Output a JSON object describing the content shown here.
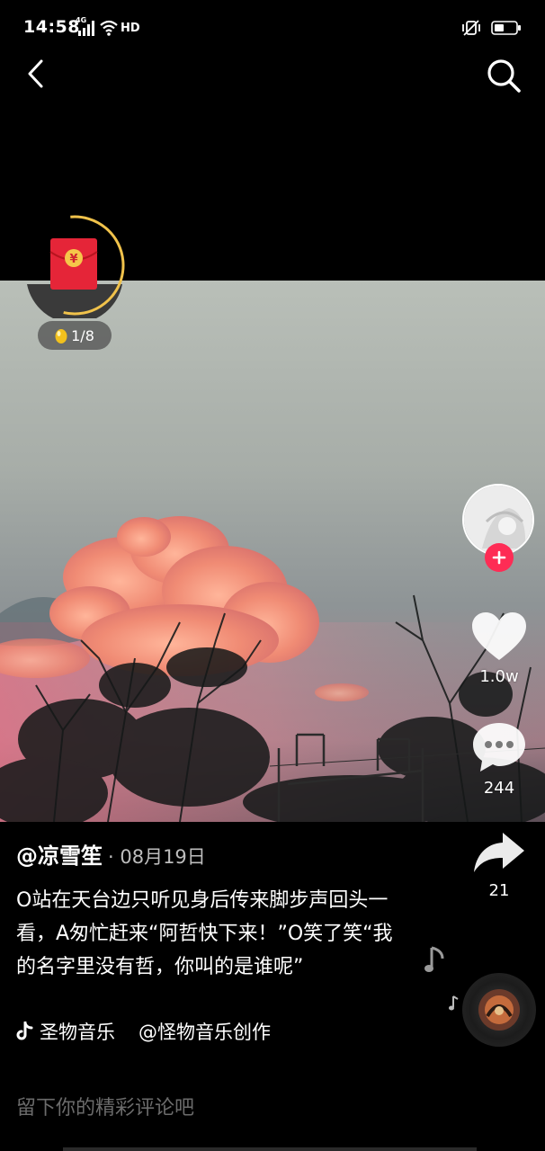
{
  "status_bar": {
    "time": "14:58",
    "network_label": "4G",
    "hd_label": "HD",
    "icons_left": [
      "signal-icon",
      "wifi-icon",
      "hd-icon"
    ],
    "icons_right": [
      "mute-vibrate-icon",
      "battery-icon"
    ]
  },
  "header": {
    "back_icon": "back-icon",
    "search_icon": "search-icon"
  },
  "redpacket": {
    "icon": "red-envelope-icon",
    "symbol": "¥",
    "progress": 0.55,
    "egg_counter": "1/8"
  },
  "right_rail": {
    "follow_icon": "plus-icon",
    "like_count": "1.0w",
    "comment_count": "244",
    "share_count": "21"
  },
  "post": {
    "author": "@凉雪笙",
    "date": "· 08月19日",
    "caption": "O站在天台边只听见身后传来脚步声回头一看，A匆忙赶来“阿哲快下来！”O笑了笑“我的名字里没有哲，你叫的是谁呢”"
  },
  "music": {
    "title": "圣物音乐",
    "creator": "@怪物音乐创作"
  },
  "comment": {
    "placeholder": "留下你的精彩评论吧"
  },
  "colors": {
    "accent": "#fe2c55",
    "progress_ring": "#f0c24b",
    "background": "#000000"
  }
}
